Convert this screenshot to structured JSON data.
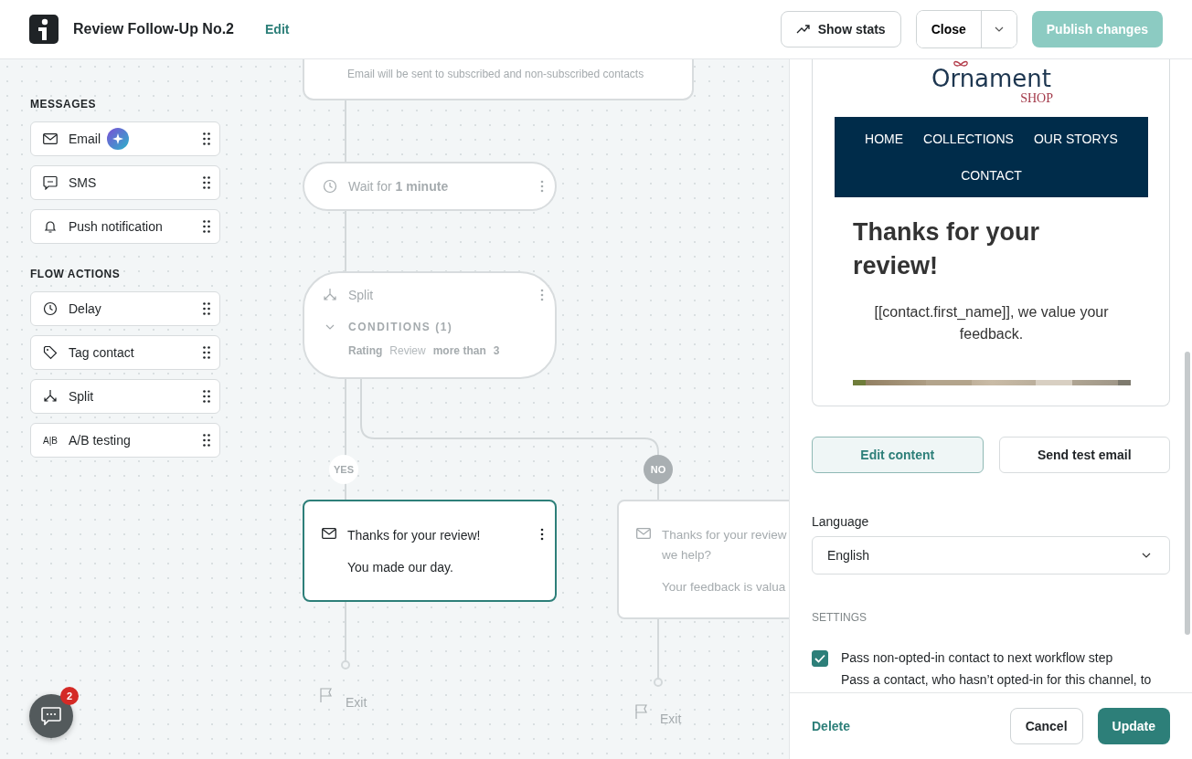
{
  "header": {
    "title": "Review Follow-Up No.2",
    "edit": "Edit",
    "stats_button": "Show stats",
    "close_button": "Close",
    "publish_button": {
      "label": "Publish changes",
      "disabled": true
    }
  },
  "palette": [
    {
      "title": "MESSAGES",
      "items": [
        {
          "label": "Email",
          "kind": "email",
          "ai_badge": true
        },
        {
          "label": "SMS",
          "kind": "sms",
          "ai_badge": false
        },
        {
          "label": "Push notification",
          "kind": "push",
          "ai_badge": false
        }
      ]
    },
    {
      "title": "FLOW ACTIONS",
      "items": [
        {
          "label": "Delay",
          "kind": "delay",
          "ai_badge": false
        },
        {
          "label": "Tag contact",
          "kind": "tag",
          "ai_badge": false
        },
        {
          "label": "Split",
          "kind": "split",
          "ai_badge": false
        },
        {
          "label": "A/B testing",
          "kind": "ab",
          "icon_text": "A|B",
          "ai_badge": false
        }
      ]
    }
  ],
  "flow": {
    "nodes": [
      {
        "kind": "email_tail",
        "note": "Email will be sent to subscribed and non-subscribed contacts",
        "selected": false
      },
      {
        "kind": "wait",
        "text": "Wait for **1 minute**",
        "selected": false
      },
      {
        "kind": "split",
        "title": "Split",
        "conditions": "CONDITIONS (1)",
        "expanded": true,
        "rule": [
          {
            "text": "Rating",
            "muted": false
          },
          {
            "text": "Review",
            "muted": true
          },
          {
            "text": "more than",
            "muted": false
          },
          {
            "text": "3",
            "muted": false
          }
        ],
        "selected": false
      },
      {
        "kind": "email",
        "lines": [
          "Thanks for your review!"
        ],
        "body": "You made our day.",
        "selected": true
      },
      {
        "kind": "email",
        "lines": [
          "Thanks for your review",
          "we help?"
        ],
        "body": "Your feedback is valua",
        "selected": false
      }
    ],
    "branches": [
      {
        "label": "YES",
        "selected": true
      },
      {
        "label": "NO",
        "selected": false
      }
    ],
    "exits": [
      "Exit",
      "Exit"
    ]
  },
  "chat": {
    "badge": "2"
  },
  "panel": {
    "preview": {
      "logo": "Ornament",
      "logo_sub": "SHOP",
      "nav": [
        "HOME",
        "COLLECTIONS",
        "OUR STORYS",
        "CONTACT"
      ],
      "heading": "Thanks for your review!",
      "text": "[[contact.first_name]], we value your feedback."
    },
    "actions": [
      {
        "label": "Edit content",
        "selected": true
      },
      {
        "label": "Send test email",
        "selected": false
      }
    ],
    "language": {
      "label": "Language",
      "value": "English"
    },
    "settings_title": "SETTINGS",
    "option": {
      "checked": true,
      "title": "Pass non-opted-in contact to next workflow step",
      "description": "Pass a contact, who hasn’t opted-in for this channel, to"
    },
    "footer": {
      "delete": "Delete",
      "cancel": "Cancel",
      "update": "Update"
    }
  }
}
